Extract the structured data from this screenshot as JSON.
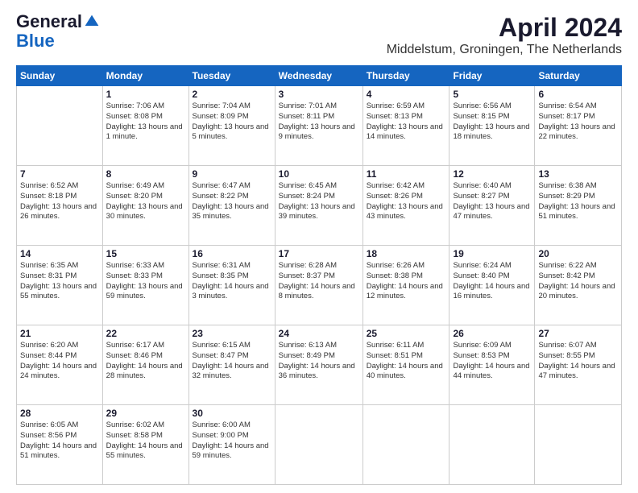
{
  "logo": {
    "general": "General",
    "blue": "Blue"
  },
  "title": "April 2024",
  "subtitle": "Middelstum, Groningen, The Netherlands",
  "days_of_week": [
    "Sunday",
    "Monday",
    "Tuesday",
    "Wednesday",
    "Thursday",
    "Friday",
    "Saturday"
  ],
  "weeks": [
    [
      {
        "day": "",
        "sunrise": "",
        "sunset": "",
        "daylight": ""
      },
      {
        "day": "1",
        "sunrise": "Sunrise: 7:06 AM",
        "sunset": "Sunset: 8:08 PM",
        "daylight": "Daylight: 13 hours and 1 minute."
      },
      {
        "day": "2",
        "sunrise": "Sunrise: 7:04 AM",
        "sunset": "Sunset: 8:09 PM",
        "daylight": "Daylight: 13 hours and 5 minutes."
      },
      {
        "day": "3",
        "sunrise": "Sunrise: 7:01 AM",
        "sunset": "Sunset: 8:11 PM",
        "daylight": "Daylight: 13 hours and 9 minutes."
      },
      {
        "day": "4",
        "sunrise": "Sunrise: 6:59 AM",
        "sunset": "Sunset: 8:13 PM",
        "daylight": "Daylight: 13 hours and 14 minutes."
      },
      {
        "day": "5",
        "sunrise": "Sunrise: 6:56 AM",
        "sunset": "Sunset: 8:15 PM",
        "daylight": "Daylight: 13 hours and 18 minutes."
      },
      {
        "day": "6",
        "sunrise": "Sunrise: 6:54 AM",
        "sunset": "Sunset: 8:17 PM",
        "daylight": "Daylight: 13 hours and 22 minutes."
      }
    ],
    [
      {
        "day": "7",
        "sunrise": "Sunrise: 6:52 AM",
        "sunset": "Sunset: 8:18 PM",
        "daylight": "Daylight: 13 hours and 26 minutes."
      },
      {
        "day": "8",
        "sunrise": "Sunrise: 6:49 AM",
        "sunset": "Sunset: 8:20 PM",
        "daylight": "Daylight: 13 hours and 30 minutes."
      },
      {
        "day": "9",
        "sunrise": "Sunrise: 6:47 AM",
        "sunset": "Sunset: 8:22 PM",
        "daylight": "Daylight: 13 hours and 35 minutes."
      },
      {
        "day": "10",
        "sunrise": "Sunrise: 6:45 AM",
        "sunset": "Sunset: 8:24 PM",
        "daylight": "Daylight: 13 hours and 39 minutes."
      },
      {
        "day": "11",
        "sunrise": "Sunrise: 6:42 AM",
        "sunset": "Sunset: 8:26 PM",
        "daylight": "Daylight: 13 hours and 43 minutes."
      },
      {
        "day": "12",
        "sunrise": "Sunrise: 6:40 AM",
        "sunset": "Sunset: 8:27 PM",
        "daylight": "Daylight: 13 hours and 47 minutes."
      },
      {
        "day": "13",
        "sunrise": "Sunrise: 6:38 AM",
        "sunset": "Sunset: 8:29 PM",
        "daylight": "Daylight: 13 hours and 51 minutes."
      }
    ],
    [
      {
        "day": "14",
        "sunrise": "Sunrise: 6:35 AM",
        "sunset": "Sunset: 8:31 PM",
        "daylight": "Daylight: 13 hours and 55 minutes."
      },
      {
        "day": "15",
        "sunrise": "Sunrise: 6:33 AM",
        "sunset": "Sunset: 8:33 PM",
        "daylight": "Daylight: 13 hours and 59 minutes."
      },
      {
        "day": "16",
        "sunrise": "Sunrise: 6:31 AM",
        "sunset": "Sunset: 8:35 PM",
        "daylight": "Daylight: 14 hours and 3 minutes."
      },
      {
        "day": "17",
        "sunrise": "Sunrise: 6:28 AM",
        "sunset": "Sunset: 8:37 PM",
        "daylight": "Daylight: 14 hours and 8 minutes."
      },
      {
        "day": "18",
        "sunrise": "Sunrise: 6:26 AM",
        "sunset": "Sunset: 8:38 PM",
        "daylight": "Daylight: 14 hours and 12 minutes."
      },
      {
        "day": "19",
        "sunrise": "Sunrise: 6:24 AM",
        "sunset": "Sunset: 8:40 PM",
        "daylight": "Daylight: 14 hours and 16 minutes."
      },
      {
        "day": "20",
        "sunrise": "Sunrise: 6:22 AM",
        "sunset": "Sunset: 8:42 PM",
        "daylight": "Daylight: 14 hours and 20 minutes."
      }
    ],
    [
      {
        "day": "21",
        "sunrise": "Sunrise: 6:20 AM",
        "sunset": "Sunset: 8:44 PM",
        "daylight": "Daylight: 14 hours and 24 minutes."
      },
      {
        "day": "22",
        "sunrise": "Sunrise: 6:17 AM",
        "sunset": "Sunset: 8:46 PM",
        "daylight": "Daylight: 14 hours and 28 minutes."
      },
      {
        "day": "23",
        "sunrise": "Sunrise: 6:15 AM",
        "sunset": "Sunset: 8:47 PM",
        "daylight": "Daylight: 14 hours and 32 minutes."
      },
      {
        "day": "24",
        "sunrise": "Sunrise: 6:13 AM",
        "sunset": "Sunset: 8:49 PM",
        "daylight": "Daylight: 14 hours and 36 minutes."
      },
      {
        "day": "25",
        "sunrise": "Sunrise: 6:11 AM",
        "sunset": "Sunset: 8:51 PM",
        "daylight": "Daylight: 14 hours and 40 minutes."
      },
      {
        "day": "26",
        "sunrise": "Sunrise: 6:09 AM",
        "sunset": "Sunset: 8:53 PM",
        "daylight": "Daylight: 14 hours and 44 minutes."
      },
      {
        "day": "27",
        "sunrise": "Sunrise: 6:07 AM",
        "sunset": "Sunset: 8:55 PM",
        "daylight": "Daylight: 14 hours and 47 minutes."
      }
    ],
    [
      {
        "day": "28",
        "sunrise": "Sunrise: 6:05 AM",
        "sunset": "Sunset: 8:56 PM",
        "daylight": "Daylight: 14 hours and 51 minutes."
      },
      {
        "day": "29",
        "sunrise": "Sunrise: 6:02 AM",
        "sunset": "Sunset: 8:58 PM",
        "daylight": "Daylight: 14 hours and 55 minutes."
      },
      {
        "day": "30",
        "sunrise": "Sunrise: 6:00 AM",
        "sunset": "Sunset: 9:00 PM",
        "daylight": "Daylight: 14 hours and 59 minutes."
      },
      {
        "day": "",
        "sunrise": "",
        "sunset": "",
        "daylight": ""
      },
      {
        "day": "",
        "sunrise": "",
        "sunset": "",
        "daylight": ""
      },
      {
        "day": "",
        "sunrise": "",
        "sunset": "",
        "daylight": ""
      },
      {
        "day": "",
        "sunrise": "",
        "sunset": "",
        "daylight": ""
      }
    ]
  ]
}
